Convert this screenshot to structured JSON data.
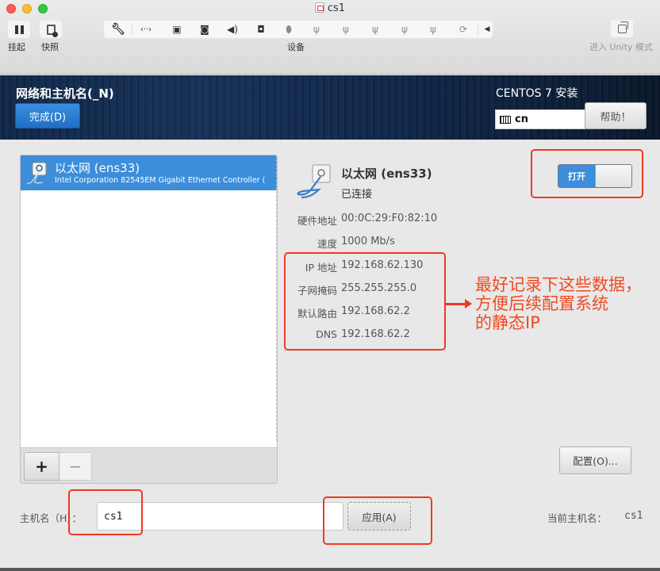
{
  "window": {
    "title": "cs1"
  },
  "toolbar": {
    "suspend_label": "挂起",
    "snapshot_label": "快照",
    "devices_label": "设备",
    "unity_label": "进入 Unity 模式",
    "device_icons": [
      "wrench-icon",
      "network-arrows-icon",
      "hard-disk-icon",
      "optical-drive-icon",
      "speaker-icon",
      "camera-icon",
      "mouse-icon",
      "usb-icon",
      "usb-icon",
      "usb-icon",
      "usb-icon",
      "usb-icon",
      "sync-icon",
      "collapse-arrow-icon"
    ]
  },
  "header": {
    "spoke_title": "网络和主机名(_N)",
    "done_button": "完成(D)",
    "product_title": "CENTOS 7 安装",
    "keyboard_layout": "cn",
    "help_button": "帮助！"
  },
  "device_list": {
    "items": [
      {
        "name": "以太网 (ens33)",
        "description": "Intel Corporation 82545EM Gigabit Ethernet Controller (",
        "selected": true
      }
    ],
    "add_button": "+",
    "remove_button": "−"
  },
  "details": {
    "name": "以太网 (ens33)",
    "status": "已连接",
    "switch_label": "打开",
    "switch_on": true,
    "properties": [
      {
        "label": "硬件地址",
        "value": "00:0C:29:F0:82:10"
      },
      {
        "label": "速度",
        "value": "1000 Mb/s"
      },
      {
        "label": "IP 地址",
        "value": "192.168.62.130"
      },
      {
        "label": "子网掩码",
        "value": "255.255.255.0"
      },
      {
        "label": "默认路由",
        "value": "192.168.62.2"
      },
      {
        "label": "DNS",
        "value": "192.168.62.2"
      }
    ],
    "configure_button": "配置(O)..."
  },
  "hostname": {
    "label": "主机名（H）：",
    "value": "cs1",
    "apply_button": "应用(A)",
    "current_label": "当前主机名：",
    "current_value": "cs1"
  },
  "annotation": {
    "line1": "最好记录下这些数据，",
    "line2": "方便后续配置系统",
    "line3": "的静态IP",
    "color": "#ee3a22"
  },
  "colors": {
    "accent_blue": "#3c8edb",
    "header_dark": "#0f2748"
  }
}
